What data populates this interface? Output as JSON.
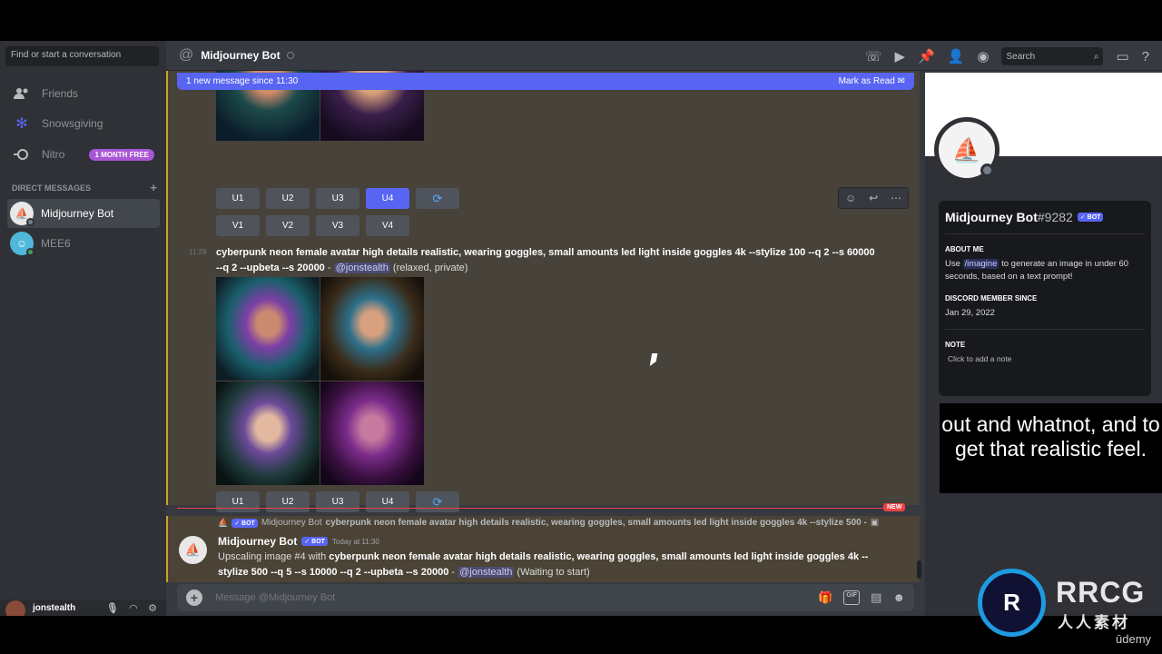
{
  "sidebar": {
    "search_placeholder": "Find or start a conversation",
    "nav": [
      {
        "label": "Friends",
        "icon": "friends-icon"
      },
      {
        "label": "Snowsgiving",
        "icon": "snowflake-icon"
      },
      {
        "label": "Nitro",
        "icon": "nitro-icon",
        "badge": "1 MONTH FREE"
      }
    ],
    "dm_header": "DIRECT MESSAGES",
    "dms": [
      {
        "name": "Midjourney Bot",
        "active": true
      },
      {
        "name": "MEE6",
        "active": false
      }
    ],
    "user": {
      "name": "jonstealth"
    }
  },
  "header": {
    "title": "Midjourney Bot",
    "search_placeholder": "Search"
  },
  "chat": {
    "banner_text": "1 new message since 11:30",
    "banner_action": "Mark as Read",
    "button_row_u": [
      "U1",
      "U2",
      "U3",
      "U4"
    ],
    "button_row_v": [
      "V1",
      "V2",
      "V3",
      "V4"
    ],
    "selected_button": "U4",
    "msg2": {
      "time": "11:29",
      "prompt": "cyberpunk neon female avatar high details realistic, wearing goggles, small amounts led light inside goggles 4k --stylize 100 --q 2 --s 60000 --q 2 --upbeta --s 20000",
      "sep": " - ",
      "mention": "@jonstealth",
      "suffix": "(relaxed, private)"
    },
    "new_label": "NEW",
    "msg3": {
      "reply_author": "Midjourney Bot",
      "reply_text": "cyberpunk neon female avatar high details realistic, wearing goggles, small amounts led light inside goggles 4k --stylize 500 -",
      "author": "Midjourney Bot",
      "bot_tag": "✓ BOT",
      "time": "Today at 11:30",
      "prefix": "Upscaling image #4 with ",
      "prompt": "cyberpunk neon female avatar high details realistic, wearing goggles, small amounts led light inside goggles 4k --stylize 500 --q 5 --s 10000 --q 2 --upbeta --s 20000",
      "sep": " - ",
      "mention": "@jonstealth",
      "suffix": " (Waiting to start)"
    },
    "input_placeholder": "Message @Midjourney Bot",
    "gif_label": "GIF"
  },
  "profile": {
    "name": "Midjourney Bot",
    "discriminator": "#9282",
    "bot_tag": "✓ BOT",
    "about_title": "ABOUT ME",
    "about_prefix": "Use ",
    "about_command": "/imagine",
    "about_suffix": " to generate an image in under 60 seconds, based on a text prompt!",
    "member_title": "DISCORD MEMBER SINCE",
    "member_since": "Jan 29, 2022",
    "note_title": "NOTE",
    "note_placeholder": "Click to add a note"
  },
  "subtitle": "out and whatnot, and to get that realistic feel.",
  "watermark": {
    "logo": "RRCG",
    "sub": "人人素材",
    "udemy": "ūdemy"
  },
  "colors": {
    "accent": "#5865f2",
    "new_red": "#ed4245",
    "highlight_border": "#c9a227"
  }
}
